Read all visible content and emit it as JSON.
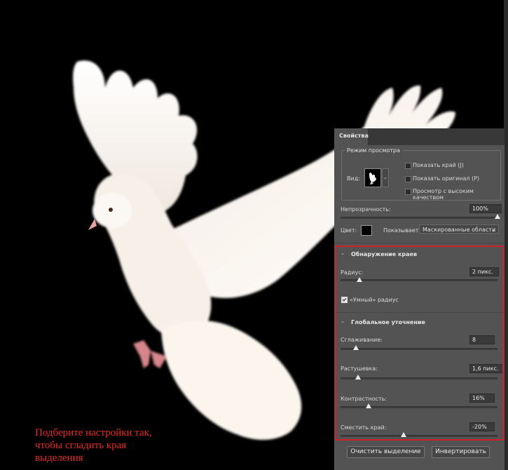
{
  "canvas": {
    "caption_lines": [
      "Подберите настройки так,",
      "чтобы сгладить края",
      "выделения"
    ],
    "colors": {
      "background": "#000000",
      "dove": "#fbf6f0",
      "caption": "#e8281e"
    }
  },
  "panel": {
    "tab_label": "Свойства",
    "view_mode": {
      "title": "Режим просмотра",
      "view_label": "Вид:",
      "checkboxes": [
        {
          "label": "Показать край (J)",
          "checked": false
        },
        {
          "label": "Показать оригинал (P)",
          "checked": false
        },
        {
          "label": "Просмотр с высоким качеством",
          "checked": false
        }
      ]
    },
    "opacity": {
      "label": "Непрозрачность:",
      "value_text": "100%",
      "value": 1.0
    },
    "color": {
      "label": "Цвет:",
      "swatch": "#000000",
      "shows_label": "Показывает:",
      "shows_value": "Маскированные области"
    },
    "edge_detection": {
      "title": "Обнаружение краев",
      "radius": {
        "label": "Радиус:",
        "value_text": "2 пикс.",
        "value": 0.12
      },
      "smart_radius": {
        "label": "«Умный» радиус",
        "checked": true
      }
    },
    "global_refinement": {
      "title": "Глобальное уточнение",
      "sliders": [
        {
          "name": "smooth",
          "label": "Сглаживание:",
          "value_text": "8",
          "value": 0.1
        },
        {
          "name": "feather",
          "label": "Растушевка:",
          "value_text": "1,6 пикс.",
          "value": 0.11
        },
        {
          "name": "contrast",
          "label": "Контрастность:",
          "value_text": "16%",
          "value": 0.18
        },
        {
          "name": "shift-edge",
          "label": "Сместить край:",
          "value_text": "-20%",
          "value": 0.4
        }
      ]
    },
    "buttons": {
      "clear": "Очистить выделение",
      "invert": "Инвертировать"
    }
  }
}
